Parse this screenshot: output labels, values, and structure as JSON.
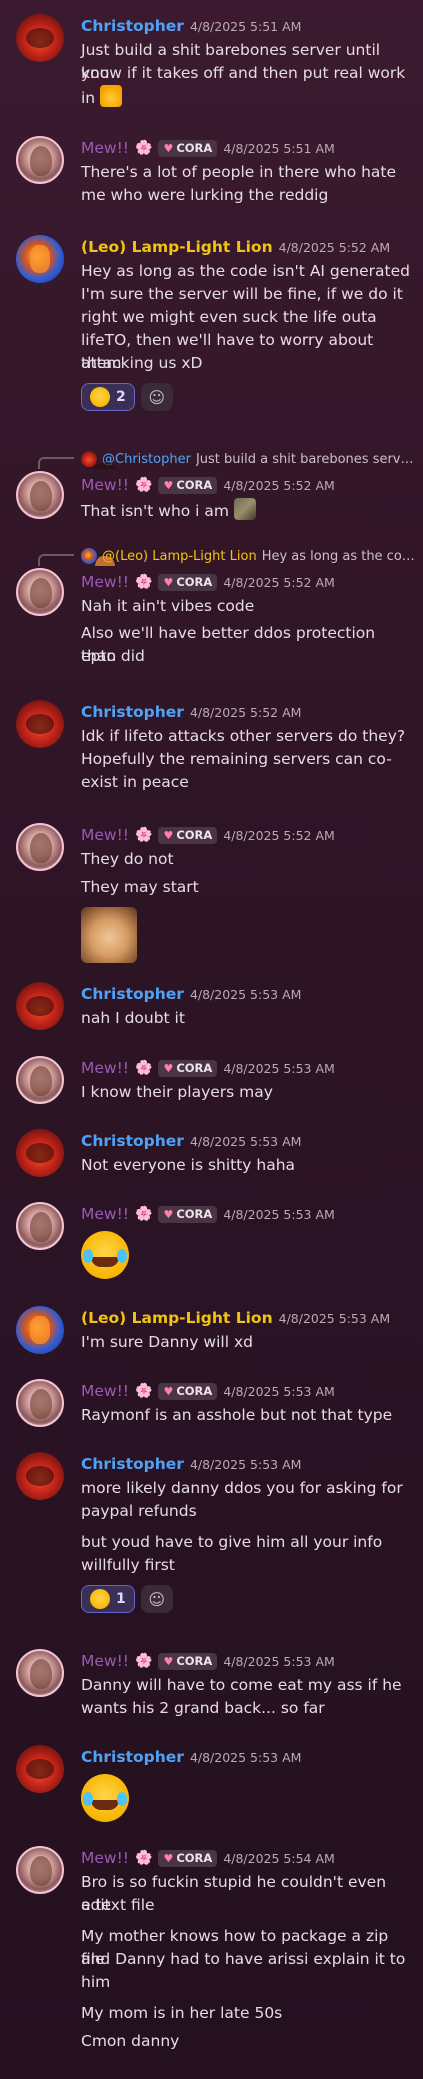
{
  "users": {
    "chris": {
      "name": "Christopher"
    },
    "mew": {
      "name": "Mew!!",
      "flower": "🌸",
      "tag": "CORA"
    },
    "lion": {
      "name": "(Leo) Lamp-Light Lion"
    }
  },
  "messages": [
    {
      "id": "m1",
      "author": "chris",
      "time": "4/8/2025 5:51 AM",
      "lines": [
        "Just build a shit barebones server until you",
        "know if it takes off and then put real work",
        "in"
      ]
    },
    {
      "id": "m2",
      "author": "mew",
      "time": "4/8/2025 5:51 AM",
      "lines": [
        "There's a lot of people in there who hate",
        "me who were lurking the reddig"
      ]
    },
    {
      "id": "m3",
      "author": "lion",
      "time": "4/8/2025 5:52 AM",
      "lines": [
        "Hey as long as the code isn't AI generated",
        "I'm sure the server will be fine, if we do it",
        "right we might even suck the life outa",
        "lifeTO, then we'll have to worry about them",
        "attacking us xD"
      ],
      "reaction_count": "2"
    },
    {
      "id": "m4",
      "author": "mew",
      "time": "4/8/2025 5:52 AM",
      "reply": {
        "author": "@Christopher",
        "text": "Just build a shit barebones server until you know if it takes off"
      },
      "lines": [
        "That isn't who i am"
      ]
    },
    {
      "id": "m5",
      "author": "mew",
      "time": "4/8/2025 5:52 AM",
      "reply": {
        "author": "@(Leo) Lamp-Light Lion",
        "text": "Hey as long as the code isn't AI generated"
      },
      "lines": [
        "Nah it ain't vibes code",
        "Also we'll have better ddos protection than",
        "epto did"
      ]
    },
    {
      "id": "m6",
      "author": "chris",
      "time": "4/8/2025 5:52 AM",
      "lines": [
        "Idk if lifeto attacks other servers do they?",
        "Hopefully the remaining servers can co-",
        "exist in peace"
      ]
    },
    {
      "id": "m7",
      "author": "mew",
      "time": "4/8/2025 5:52 AM",
      "lines": [
        "They do not",
        "They may start"
      ]
    },
    {
      "id": "m8",
      "author": "chris",
      "time": "4/8/2025 5:53 AM",
      "lines": [
        "nah I doubt it"
      ]
    },
    {
      "id": "m9",
      "author": "mew",
      "time": "4/8/2025 5:53 AM",
      "lines": [
        "I know their players may"
      ]
    },
    {
      "id": "m10",
      "author": "chris",
      "time": "4/8/2025 5:53 AM",
      "lines": [
        "Not everyone is shitty haha"
      ]
    },
    {
      "id": "m11",
      "author": "mew",
      "time": "4/8/2025 5:53 AM",
      "lines": []
    },
    {
      "id": "m12",
      "author": "lion",
      "time": "4/8/2025 5:53 AM",
      "lines": [
        "I'm sure Danny will xd"
      ]
    },
    {
      "id": "m13",
      "author": "mew",
      "time": "4/8/2025 5:53 AM",
      "lines": [
        "Raymonf is an asshole but not that type"
      ]
    },
    {
      "id": "m14",
      "author": "chris",
      "time": "4/8/2025 5:53 AM",
      "lines": [
        "more likely danny ddos you for asking for",
        "paypal refunds",
        "but youd have to give him all your info",
        "willfully first"
      ],
      "reaction_count": "1"
    },
    {
      "id": "m15",
      "author": "mew",
      "time": "4/8/2025 5:53 AM",
      "lines": [
        "Danny will have to come eat my ass if he",
        "wants his 2 grand back... so far"
      ]
    },
    {
      "id": "m16",
      "author": "chris",
      "time": "4/8/2025 5:53 AM",
      "lines": []
    },
    {
      "id": "m17",
      "author": "mew",
      "time": "4/8/2025 5:54 AM",
      "lines": [
        "Bro is so fuckin stupid he couldn't even edit",
        "a text file",
        "My mother knows how to package a zip file",
        "and Danny had to have arissi explain it to",
        "him",
        "My mom is in her late 50s",
        "Cmon danny"
      ]
    }
  ],
  "icons": {
    "reaction": "rofl-emoji",
    "add_reaction": "add-reaction-icon",
    "thumbs": "thumbs-up-emoji",
    "cat": "cat-emoji"
  }
}
